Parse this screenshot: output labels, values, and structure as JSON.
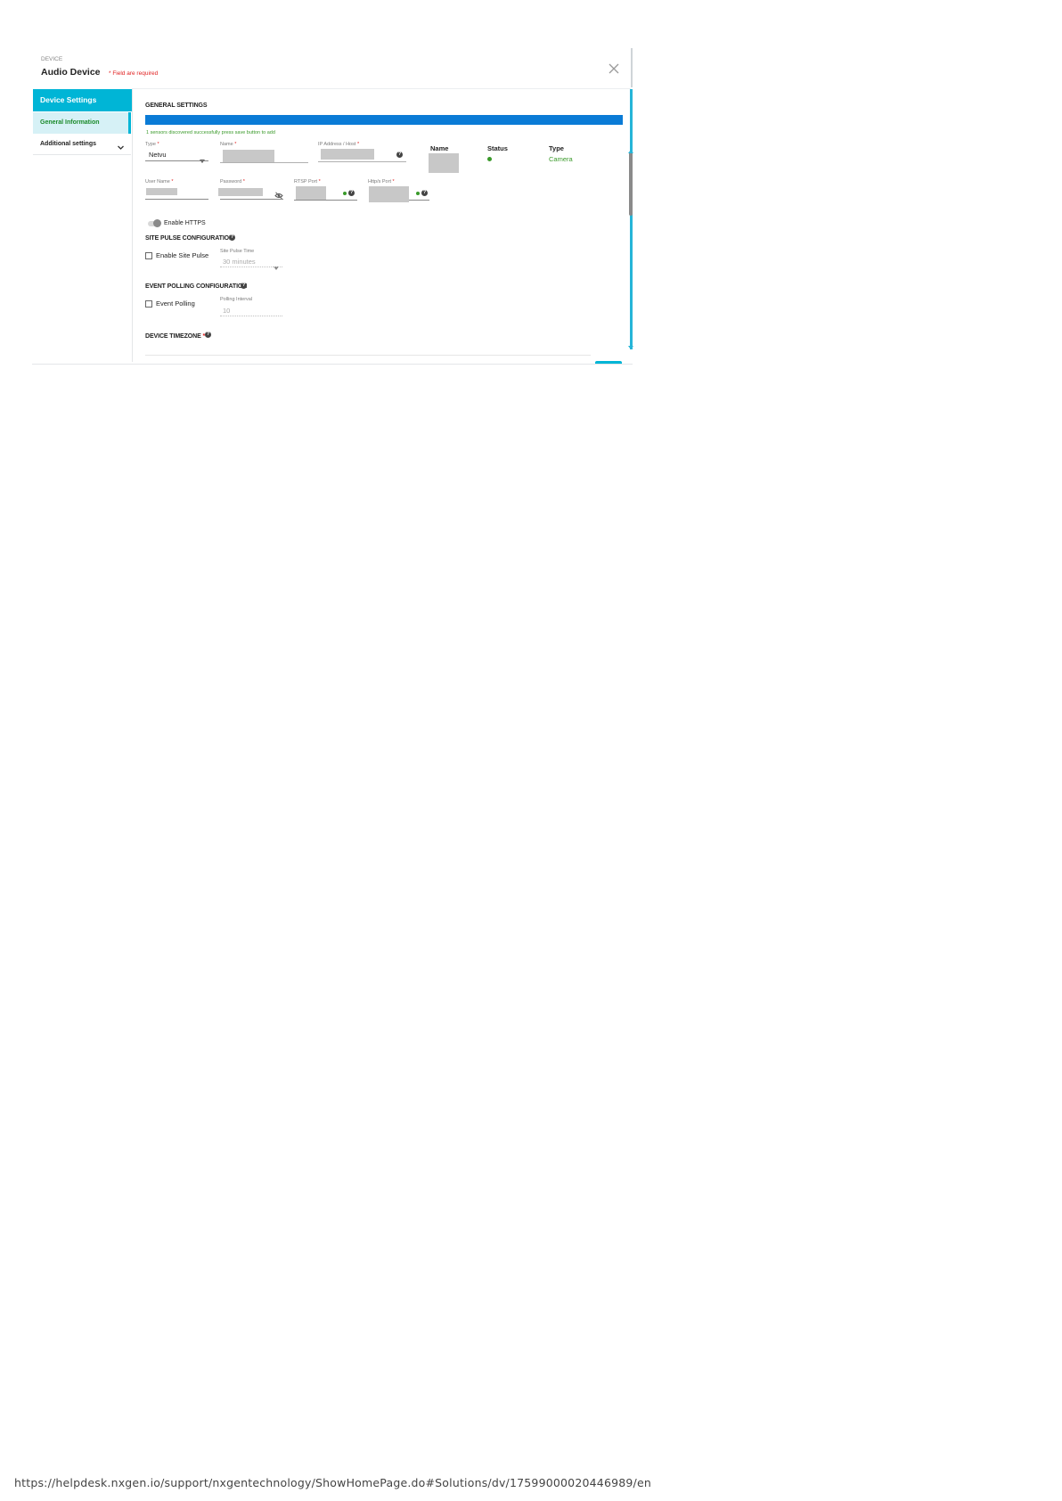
{
  "dialog": {
    "breadcrumb": "DEVICE",
    "title": "Audio Device",
    "required_note": "* Field are required"
  },
  "sidebar": {
    "header": "Device Settings",
    "items": [
      {
        "label": "General Information",
        "active": true
      },
      {
        "label": "Additional settings",
        "expandable": true
      }
    ]
  },
  "general": {
    "section_title": "GENERAL SETTINGS",
    "success_message": "1 sensors discovered successfully press save button to add",
    "type_label": "Type",
    "type_value": "Netvu",
    "name_label": "Name",
    "ip_label": "IP Address / Host",
    "username_label": "User Name",
    "password_label": "Password",
    "rtsp_label": "RTSP Port",
    "https_label": "Http/s Port",
    "required_star": "*",
    "enable_https": "Enable HTTPS"
  },
  "sensors_table": {
    "headers": [
      "Name",
      "Status",
      "Type"
    ],
    "rows": [
      {
        "status": "online",
        "type": "Camera"
      }
    ]
  },
  "site_pulse": {
    "section_title": "SITE PULSE CONFIGURATION",
    "checkbox_label": "Enable Site Pulse",
    "time_label": "Site Pulse Time",
    "time_value": "30 minutes"
  },
  "event_polling": {
    "section_title": "EVENT POLLING CONFIGURATION",
    "checkbox_label": "Event Polling",
    "interval_label": "Polling Interval",
    "interval_value": "10"
  },
  "timezone": {
    "section_title": "DEVICE TIMEZONE",
    "required_star": "*"
  },
  "footer": {
    "url": "https://helpdesk.nxgen.io/support/nxgentechnology/ShowHomePage.do#Solutions/dv/17599000020446989/en"
  },
  "colors": {
    "accent": "#00b5d6",
    "progress_blue": "#0a7bd6",
    "success_green": "#3a9a2a",
    "required_red": "#e02020"
  }
}
